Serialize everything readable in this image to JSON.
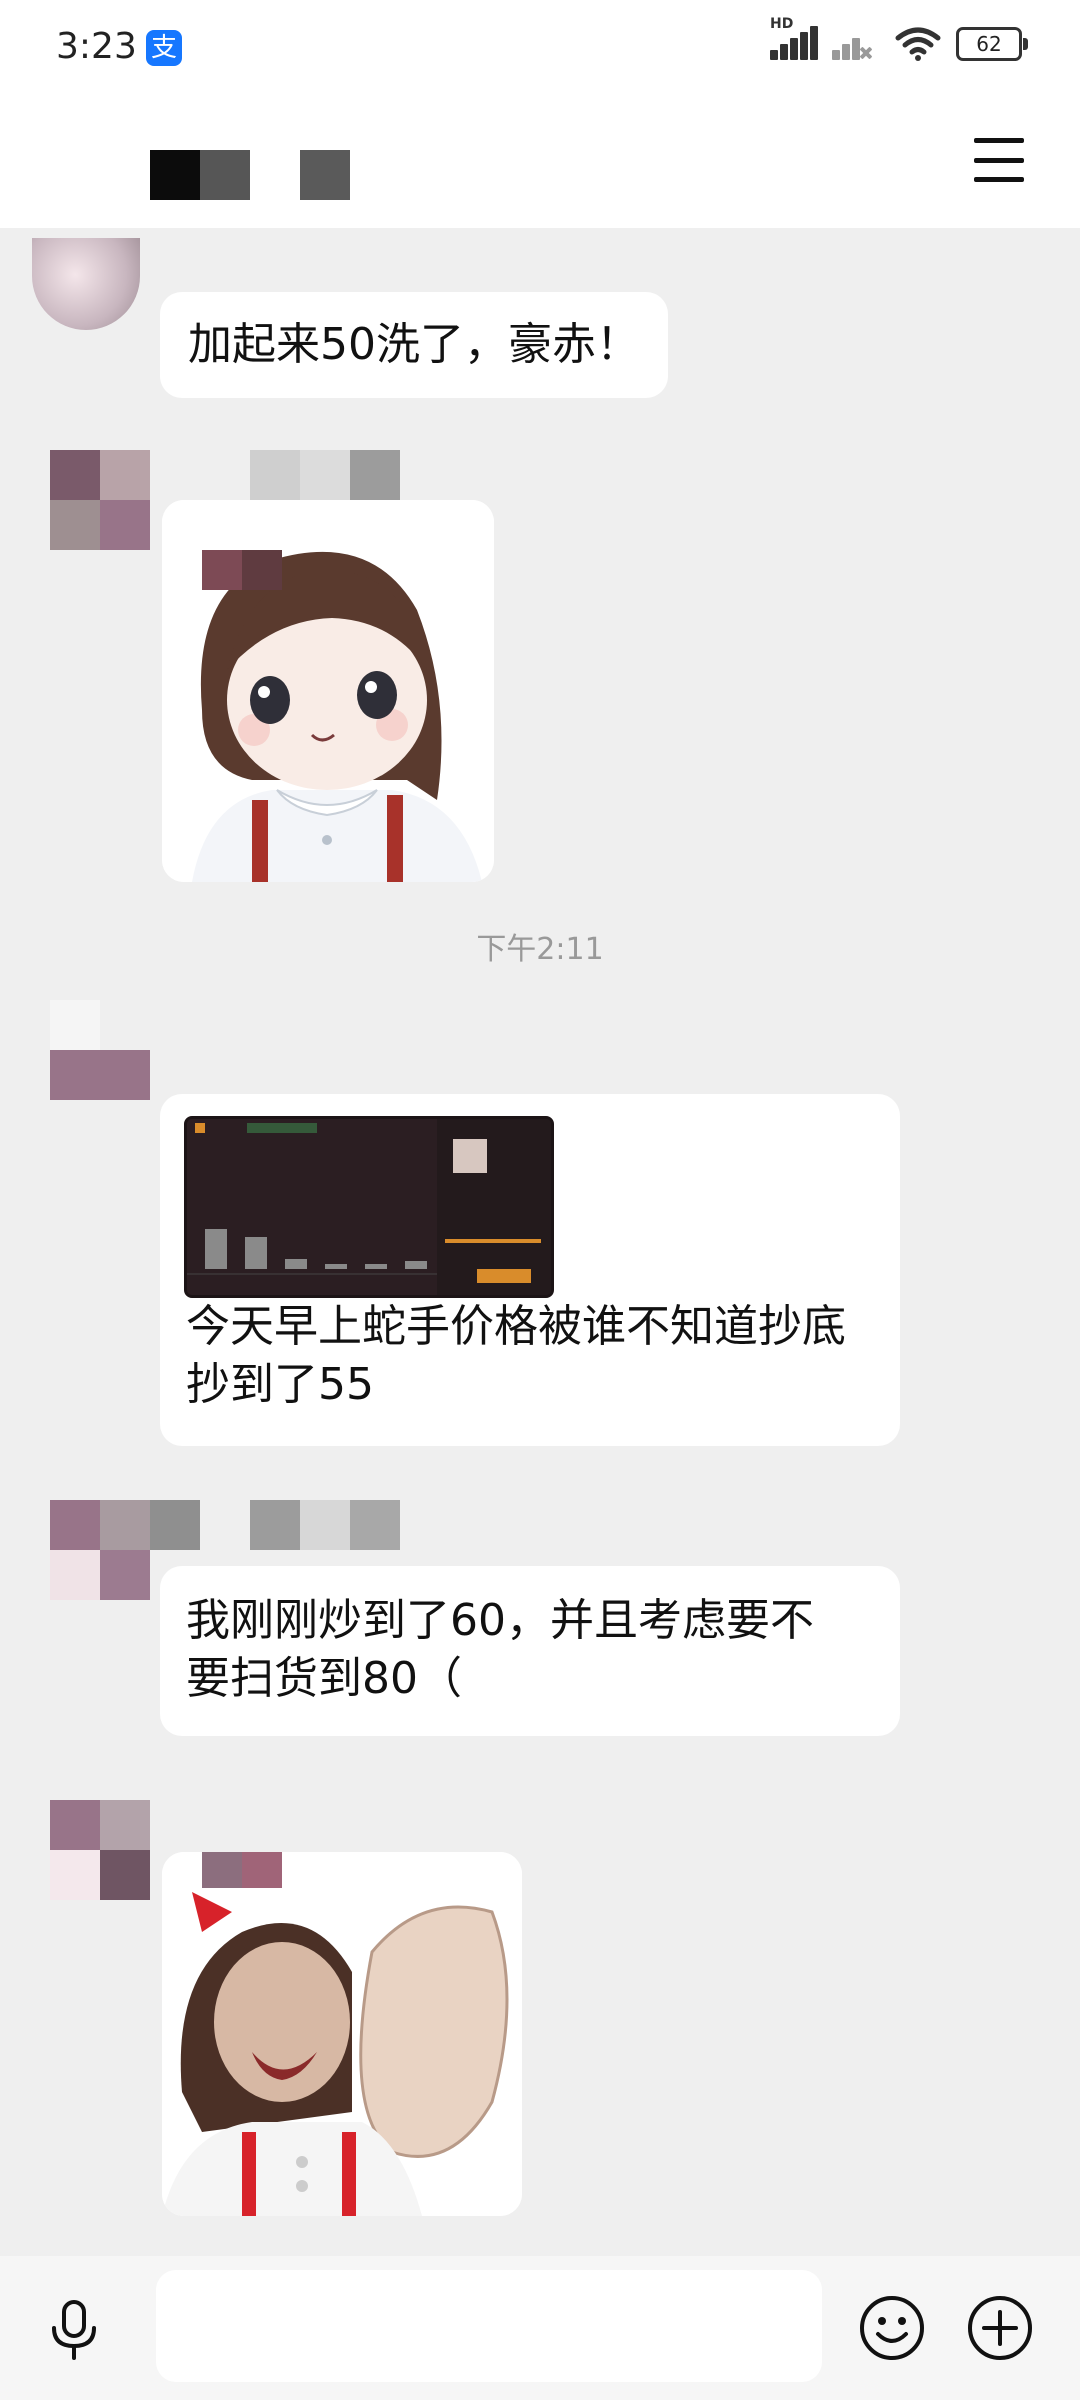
{
  "status_bar": {
    "time": "3:23",
    "alipay_glyph": "支",
    "hd_label": "HD",
    "battery": "62",
    "icons": [
      "alipay-icon",
      "signal-icon",
      "signal-weak-icon",
      "wifi-icon",
      "battery-icon"
    ]
  },
  "header": {
    "menu_icon": "hamburger-menu-icon"
  },
  "messages": [
    {
      "type": "text",
      "text": "加起来50洗了，豪赤！"
    },
    {
      "type": "image",
      "alt_icon": "sticker-anime-girl"
    },
    {
      "type": "time",
      "text": "下午2:11"
    },
    {
      "type": "image_text",
      "lines": [
        "今天早上蛇手价格被谁不知道抄底",
        "抄到了55"
      ]
    },
    {
      "type": "text",
      "lines": [
        "我刚刚炒到了60，并且考虑要不",
        "要扫货到80（"
      ]
    },
    {
      "type": "image",
      "alt_icon": "sticker-meme"
    }
  ],
  "input_bar": {
    "voice_icon": "microphone-icon",
    "emoji_icon": "emoji-icon",
    "plus_icon": "plus-icon"
  },
  "colors": {
    "background": "#efefef",
    "bubble": "#ffffff",
    "accent_alipay": "#1677ff"
  }
}
